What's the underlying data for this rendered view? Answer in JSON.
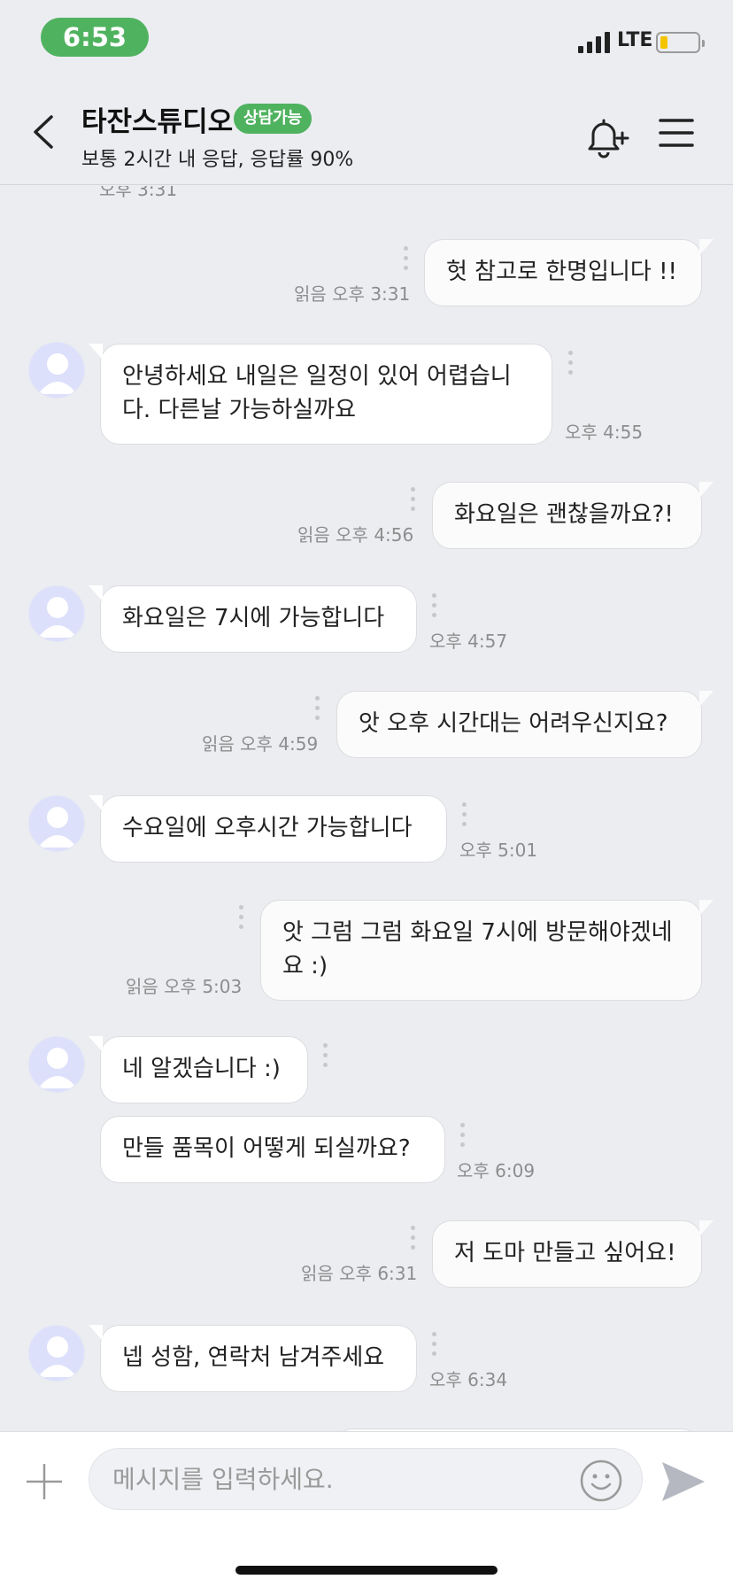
{
  "status_bar": {
    "time": "6:53",
    "network": "LTE",
    "battery_level": 0.2,
    "colors": {
      "time_pill": "#4fb25f",
      "battery_fill": "#f5c400"
    }
  },
  "header": {
    "back_icon": "chevron-left-icon",
    "title": "타잔스튜디오",
    "badge": "상담가능",
    "subtitle": "보통 2시간 내 응답, 응답률 90%",
    "bell_icon": "bell-plus-icon",
    "menu_icon": "hamburger-menu-icon",
    "colors": {
      "badge": "#4fb25f"
    }
  },
  "chat": {
    "clipped_time": "오후 3:31",
    "messages": [
      {
        "sender": "me",
        "text": "헛 참고로 한명입니다 !!",
        "meta": "읽음 오후 3:31"
      },
      {
        "sender": "them",
        "text": "안녕하세요 내일은 일정이 있어 어렵습니다. 다른날 가능하실까요",
        "meta": "오후 4:55"
      },
      {
        "sender": "me",
        "text": "화요일은 괜찮을까요?!",
        "meta": "읽음 오후 4:56"
      },
      {
        "sender": "them",
        "text": "화요일은 7시에 가능합니다",
        "meta": "오후 4:57"
      },
      {
        "sender": "me",
        "text": "앗 오후 시간대는 어려우신지요?",
        "meta": "읽음 오후 4:59"
      },
      {
        "sender": "them",
        "text": "수요일에 오후시간 가능합니다",
        "meta": "오후 5:01"
      },
      {
        "sender": "me",
        "text": "앗 그럼 그럼 화요일 7시에 방문해야겠네요 :)",
        "meta": "읽음 오후 5:03"
      },
      {
        "sender": "them",
        "text": "네 알겠습니다 :)",
        "meta": ""
      },
      {
        "sender": "them",
        "text": "만들 품목이 어떻게 되실까요?",
        "meta": "오후 6:09"
      },
      {
        "sender": "me",
        "text": "저 도마 만들고 싶어요!",
        "meta": "읽음 오후 6:31"
      },
      {
        "sender": "them",
        "text": "넵 성함, 연락처 남겨주세요",
        "meta": "오후 6:34"
      }
    ]
  },
  "input_bar": {
    "plus_icon": "plus-icon",
    "placeholder": "메시지를 입력하세요.",
    "emoji_icon": "smiley-icon",
    "send_icon": "send-arrow-icon"
  }
}
